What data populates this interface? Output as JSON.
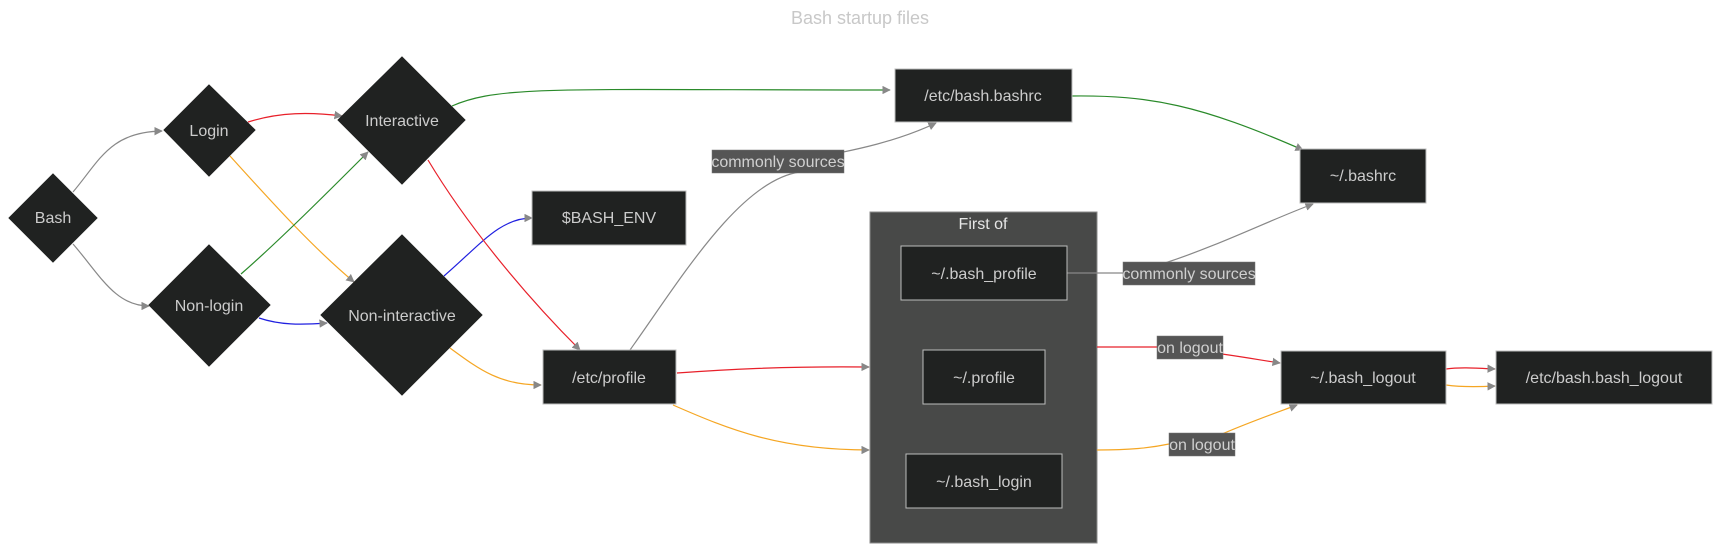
{
  "title": "Bash startup files",
  "nodes": {
    "bash": "Bash",
    "login": "Login",
    "nonlogin": "Non-login",
    "interactive": "Interactive",
    "noninteractive": "Non-interactive",
    "bash_env": "$BASH_ENV",
    "etc_profile": "/etc/profile",
    "etc_bashrc": "/etc/bash.bashrc",
    "bashrc": "~/.bashrc",
    "bash_profile": "~/.bash_profile",
    "profile": "~/.profile",
    "bash_login": "~/.bash_login",
    "bash_logout": "~/.bash_logout",
    "etc_bash_logout": "/etc/bash.bash_logout"
  },
  "cluster": {
    "label": "First of"
  },
  "edge_labels": {
    "commonly_sources_1": "commonly sources",
    "commonly_sources_2": "commonly sources",
    "on_logout_1": "on logout",
    "on_logout_2": "on logout"
  },
  "colors": {
    "gray": "#888888",
    "red": "#e8202a",
    "orange": "#f5a623",
    "green": "#2a8a2a",
    "blue": "#2020e0"
  }
}
